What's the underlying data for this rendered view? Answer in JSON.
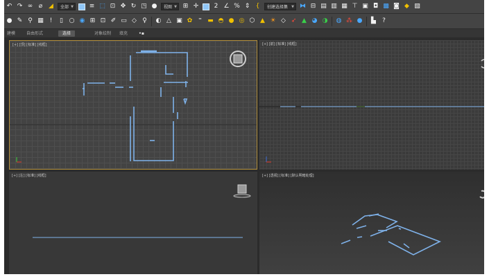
{
  "toolbar_main": {
    "selection_filter": "全部",
    "reference_coord": "视图",
    "named_selection": "创建选择集"
  },
  "ribbon": {
    "tabs": [
      "建模",
      "自由形式",
      "选择",
      "对象绘制",
      "填充"
    ],
    "active_tab": "选择",
    "extra_icon": "dots-menu-icon"
  },
  "viewports": {
    "top_label": "[+] [顶] [标准] [线框]",
    "front_label": "[+] [前] [标准] [线框]",
    "left_label": "[+] [左] [标准] [线框]",
    "persp_label": "[+] [透视] [标准] [默认明暗处理]"
  },
  "colors": {
    "shape_lines": "#7fb2ea",
    "active_border": "#b08d3a",
    "viewcube": "#cfcfcf"
  }
}
